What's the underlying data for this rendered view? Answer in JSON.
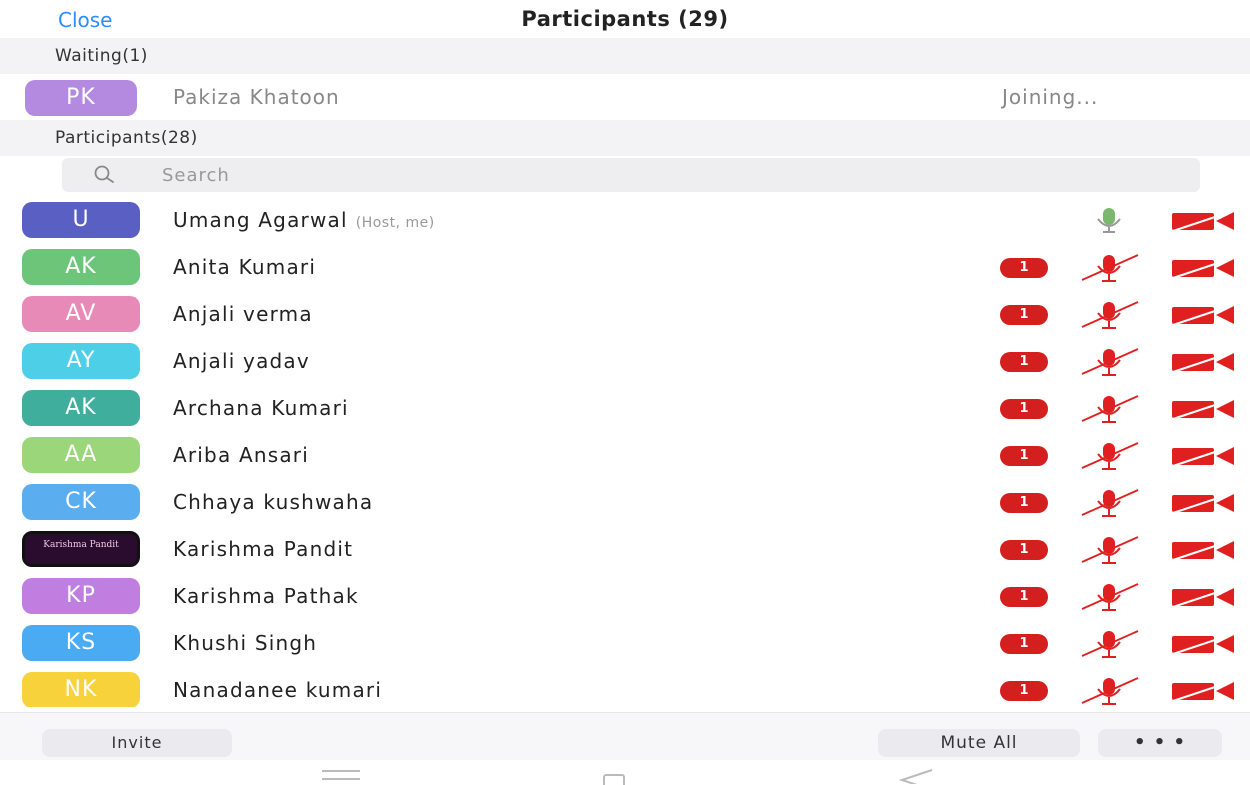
{
  "header": {
    "close_label": "Close",
    "title": "Participants (29)"
  },
  "waiting": {
    "section_label": "Waiting(1)",
    "person": {
      "initials": "PK",
      "name": "Pakiza Khatoon",
      "status": "Joining...",
      "color": "#b48ae0"
    }
  },
  "participants_section_label": "Participants(28)",
  "search": {
    "placeholder": "Search",
    "icon": "search-icon"
  },
  "participants": [
    {
      "initials": "U",
      "name": "Umang Agarwal",
      "role": "(Host, me)",
      "color": "#5a5fc4",
      "badge": "",
      "mic": "active",
      "video": "off"
    },
    {
      "initials": "AK",
      "name": "Anita Kumari",
      "role": "",
      "color": "#6dc57a",
      "badge": "1",
      "mic": "muted",
      "video": "off"
    },
    {
      "initials": "AV",
      "name": "Anjali verma",
      "role": "",
      "color": "#e88ab8",
      "badge": "1",
      "mic": "muted",
      "video": "off"
    },
    {
      "initials": "AY",
      "name": "Anjali yadav",
      "role": "",
      "color": "#4dcfe8",
      "badge": "1",
      "mic": "muted",
      "video": "off"
    },
    {
      "initials": "AK",
      "name": "Archana Kumari",
      "role": "",
      "color": "#3fae9c",
      "badge": "1",
      "mic": "muted",
      "video": "off"
    },
    {
      "initials": "AA",
      "name": "Ariba Ansari",
      "role": "",
      "color": "#9bd67a",
      "badge": "1",
      "mic": "muted",
      "video": "off"
    },
    {
      "initials": "CK",
      "name": "Chhaya kushwaha",
      "role": "",
      "color": "#5aaef0",
      "badge": "1",
      "mic": "muted",
      "video": "off"
    },
    {
      "initials": "Karishma Pandit",
      "name": "Karishma Pandit",
      "role": "",
      "color": "#2a0c2e",
      "badge": "1",
      "mic": "muted",
      "video": "off",
      "photo": true
    },
    {
      "initials": "KP",
      "name": "Karishma Pathak",
      "role": "",
      "color": "#c07ee0",
      "badge": "1",
      "mic": "muted",
      "video": "off"
    },
    {
      "initials": "KS",
      "name": "Khushi Singh",
      "role": "",
      "color": "#4aaaf2",
      "badge": "1",
      "mic": "muted",
      "video": "off"
    },
    {
      "initials": "NK",
      "name": "Nanadanee kumari",
      "role": "",
      "color": "#f7d23a",
      "badge": "1",
      "mic": "muted",
      "video": "off"
    }
  ],
  "footer": {
    "invite_label": "Invite",
    "mute_all_label": "Mute All",
    "more_label": "• • •"
  },
  "colors": {
    "accent": "#2d8cff",
    "muted_red": "#e02020",
    "mic_active": "#7ab86e"
  }
}
